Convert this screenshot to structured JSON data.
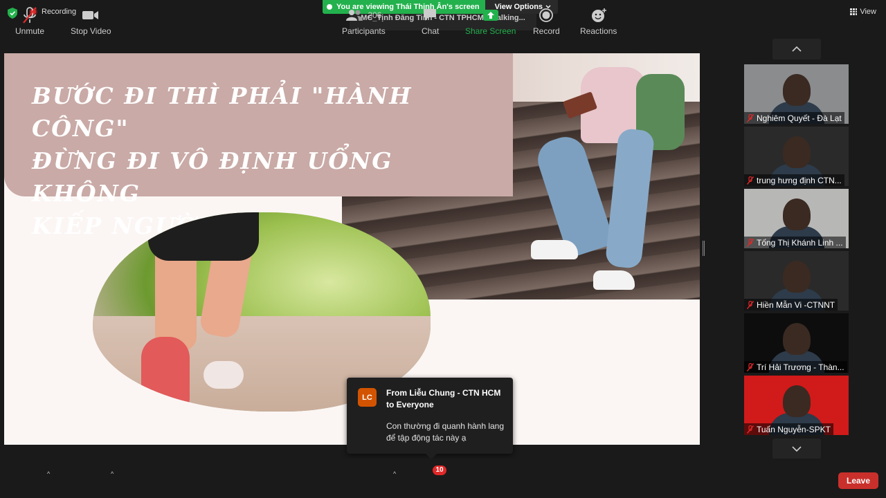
{
  "topbar": {
    "recording_label": "Recording",
    "viewing_label": "You are viewing Thái Thịnh Ân's screen",
    "view_options_label": "View Options",
    "talking_label": "MC_Tịnh Đăng Tinh - CTN TPHCM is talking...",
    "view_label": "View"
  },
  "slide": {
    "title_line1": "BƯỚC ĐI THÌ PHẢI \"HÀNH CÔNG\"",
    "title_line2": "ĐỪNG ĐI VÔ ĐỊNH UỔNG KHÔNG",
    "title_line3": "KIẾP NGƯỜI"
  },
  "chat_popup": {
    "avatar_initials": "LC",
    "from": "From Liễu Chung - CTN HCM to Everyone",
    "message": "Con thường đi quanh hành lang để tập động tác này ạ"
  },
  "participants_panel": [
    {
      "name": "Nghiêm Quyết - Đà Lạt",
      "bg": "#8a8c8e"
    },
    {
      "name": "trung hưng định CTN...",
      "bg": "#2a2a2a"
    },
    {
      "name": "Tống Thị Khánh Linh ...",
      "bg": "#b7b7b5"
    },
    {
      "name": "Hiền Mẫn Vi -CTNNT",
      "bg": "#2a2a2a"
    },
    {
      "name": "Trí Hải Trương - Thàn...",
      "bg": "#0d0d0d"
    },
    {
      "name": "Tuấn Nguyễn-SPKT",
      "bg": "#d11a1a"
    }
  ],
  "toolbar": {
    "unmute": "Unmute",
    "stop_video": "Stop Video",
    "participants": "Participants",
    "participants_count": "206",
    "chat": "Chat",
    "chat_badge": "10",
    "share_screen": "Share Screen",
    "record": "Record",
    "reactions": "Reactions",
    "leave": "Leave"
  },
  "colors": {
    "accent_green": "#23b14d",
    "leave_red": "#c9302c",
    "avatar_orange": "#d35400"
  }
}
